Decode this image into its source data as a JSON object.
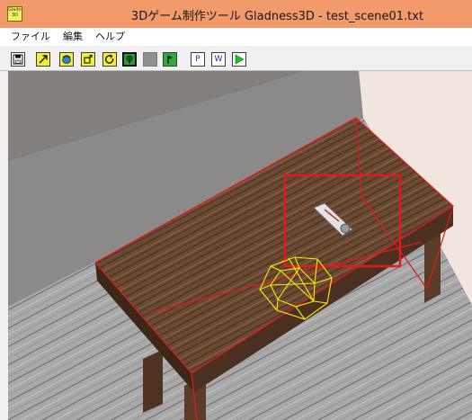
{
  "window": {
    "title": "3Dゲーム制作ツール Gladness3D - test_scene01.txt",
    "icon_label": "Gladness 3D",
    "colors": {
      "titlebar": "#f29a6a",
      "selection": "#e11a1a",
      "wireframe": "#f5f000"
    }
  },
  "menu": {
    "items": [
      {
        "label": "ファイル"
      },
      {
        "label": "編集"
      },
      {
        "label": "ヘルプ"
      }
    ]
  },
  "toolbar": {
    "buttons": [
      {
        "icon": "save-icon"
      },
      {
        "icon": "move-arrow-icon"
      },
      {
        "icon": "rotate-object-icon"
      },
      {
        "icon": "move-object-icon"
      },
      {
        "icon": "refresh-rotate-icon"
      },
      {
        "icon": "tree-object-icon"
      },
      {
        "icon": "blank-gray-icon"
      },
      {
        "icon": "flag-icon"
      },
      {
        "label": "P",
        "icon": "p-text-icon"
      },
      {
        "label": "W",
        "icon": "w-text-icon"
      },
      {
        "icon": "play-icon"
      }
    ]
  }
}
